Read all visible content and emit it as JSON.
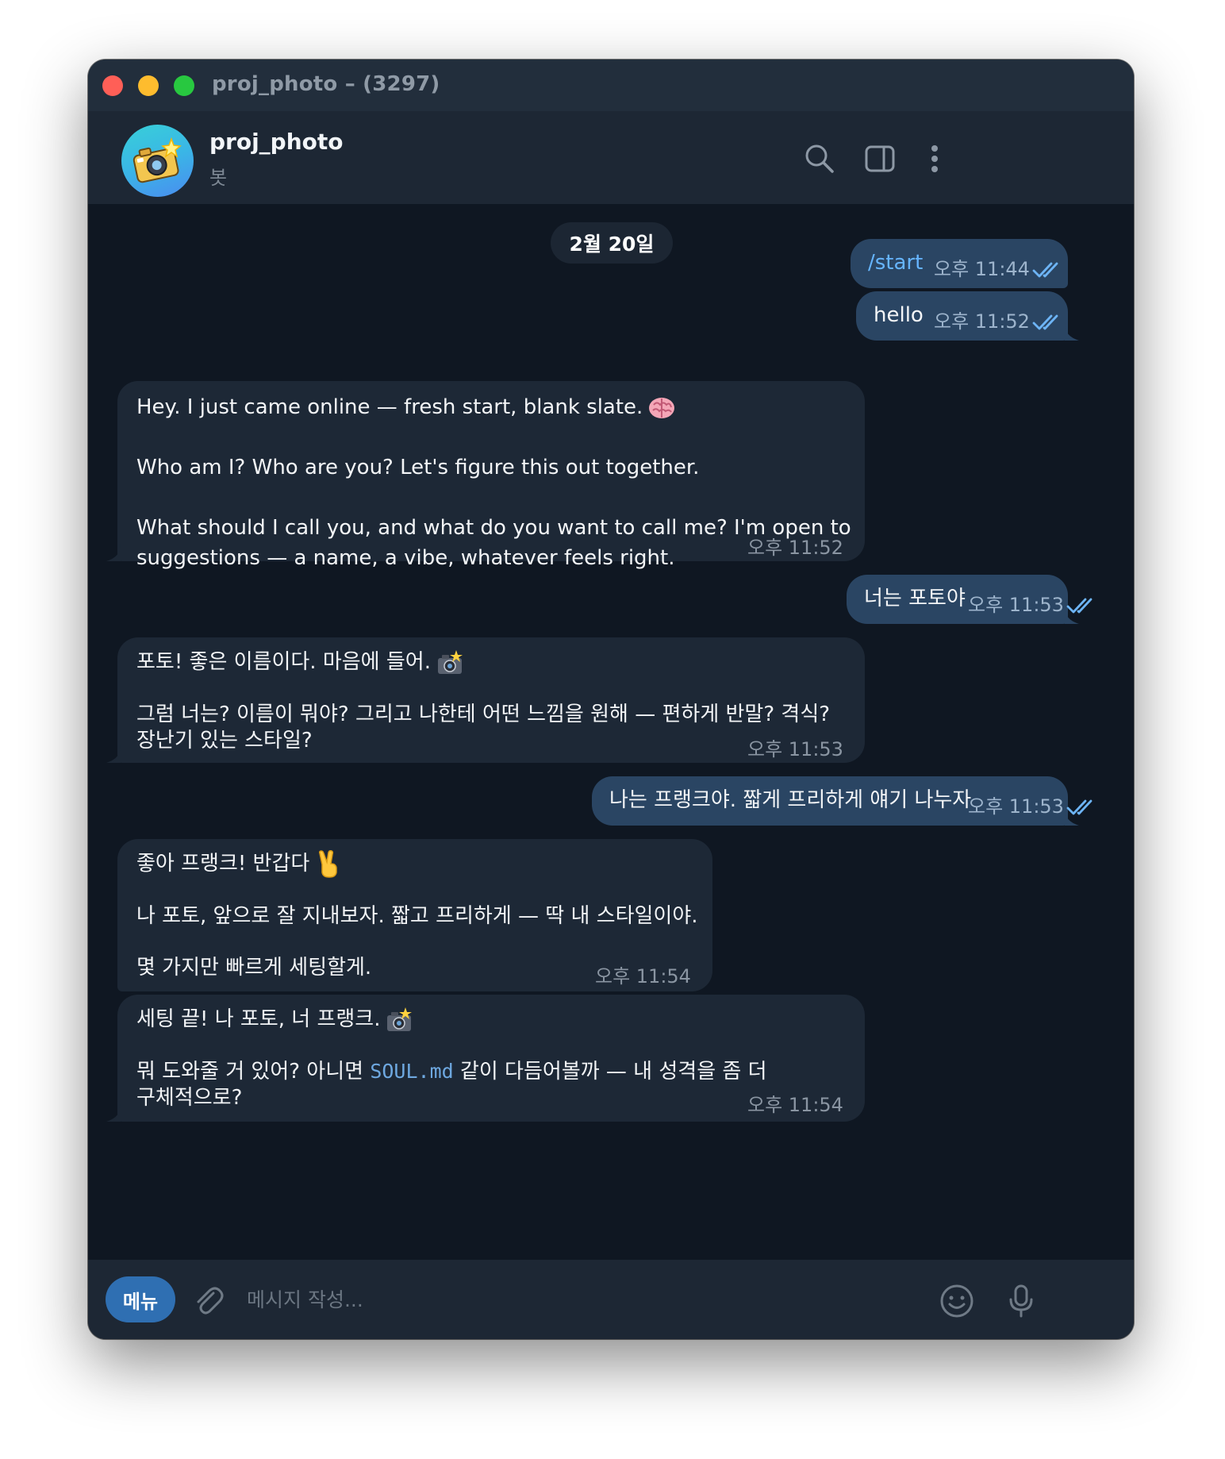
{
  "window": {
    "title": "proj_photo – (3297)"
  },
  "header": {
    "name": "proj_photo",
    "subtitle": "봇",
    "icons": [
      "search-icon",
      "sidebar-toggle-icon",
      "more-vertical-icon"
    ]
  },
  "date_separator": "2월 20일",
  "messages": [
    {
      "dir": "out",
      "text": "/start",
      "time": "오후 11:44",
      "status": "read"
    },
    {
      "dir": "out",
      "text": "hello",
      "time": "오후 11:52",
      "status": "read"
    },
    {
      "dir": "in",
      "lines": [
        "Hey. I just came online — fresh start, blank slate.",
        "",
        "Who am I? Who are you? Let's figure this out together.",
        "",
        "What should I call you, and what do you want to call me? I'm open to",
        "suggestions — a name, a vibe, whatever feels right."
      ],
      "emoji": "brain-emoji",
      "time": "오후 11:52"
    },
    {
      "dir": "out",
      "text": "너는 포토야",
      "time": "오후 11:53",
      "status": "read"
    },
    {
      "dir": "in",
      "lines": [
        "포토! 좋은 이름이다. 마음에 들어.",
        "",
        "그럼 너는? 이름이 뭐야? 그리고 나한테 어떤 느낌을 원해 — 편하게 반말? 격식?",
        "장난기 있는 스타일?"
      ],
      "emoji": "camera-flash-emoji",
      "time": "오후 11:53"
    },
    {
      "dir": "out",
      "text": "나는 프랭크야. 짧게 프리하게 얘기 나누자",
      "time": "오후 11:53",
      "status": "read"
    },
    {
      "dir": "in",
      "lines": [
        "좋아 프랭크! 반갑다",
        "",
        "나 포토, 앞으로 잘 지내보자. 짧고 프리하게 — 딱 내 스타일이야.",
        "",
        "몇 가지만 빠르게 세팅할게."
      ],
      "emoji": "victory-hand-emoji",
      "time": "오후 11:54"
    },
    {
      "dir": "in",
      "lines": [
        "세팅 끝! 나 포토, 너 프랭크.",
        "",
        "뭐 도와줄 거 있어? 아니면 ",
        "구체적으로?"
      ],
      "code": "SOUL.md",
      "after_code": " 같이 다듬어볼까 — 내 성격을 좀 더",
      "emoji": "camera-flash-emoji",
      "time": "오후 11:54"
    }
  ],
  "composer": {
    "menu_label": "메뉴",
    "placeholder": "메시지 작성..."
  },
  "colors": {
    "background": "#0f1722",
    "incoming_bubble": "#1d2836",
    "outgoing_bubble": "#2a4563",
    "accent": "#2f6fb2",
    "link": "#66b5ff"
  }
}
